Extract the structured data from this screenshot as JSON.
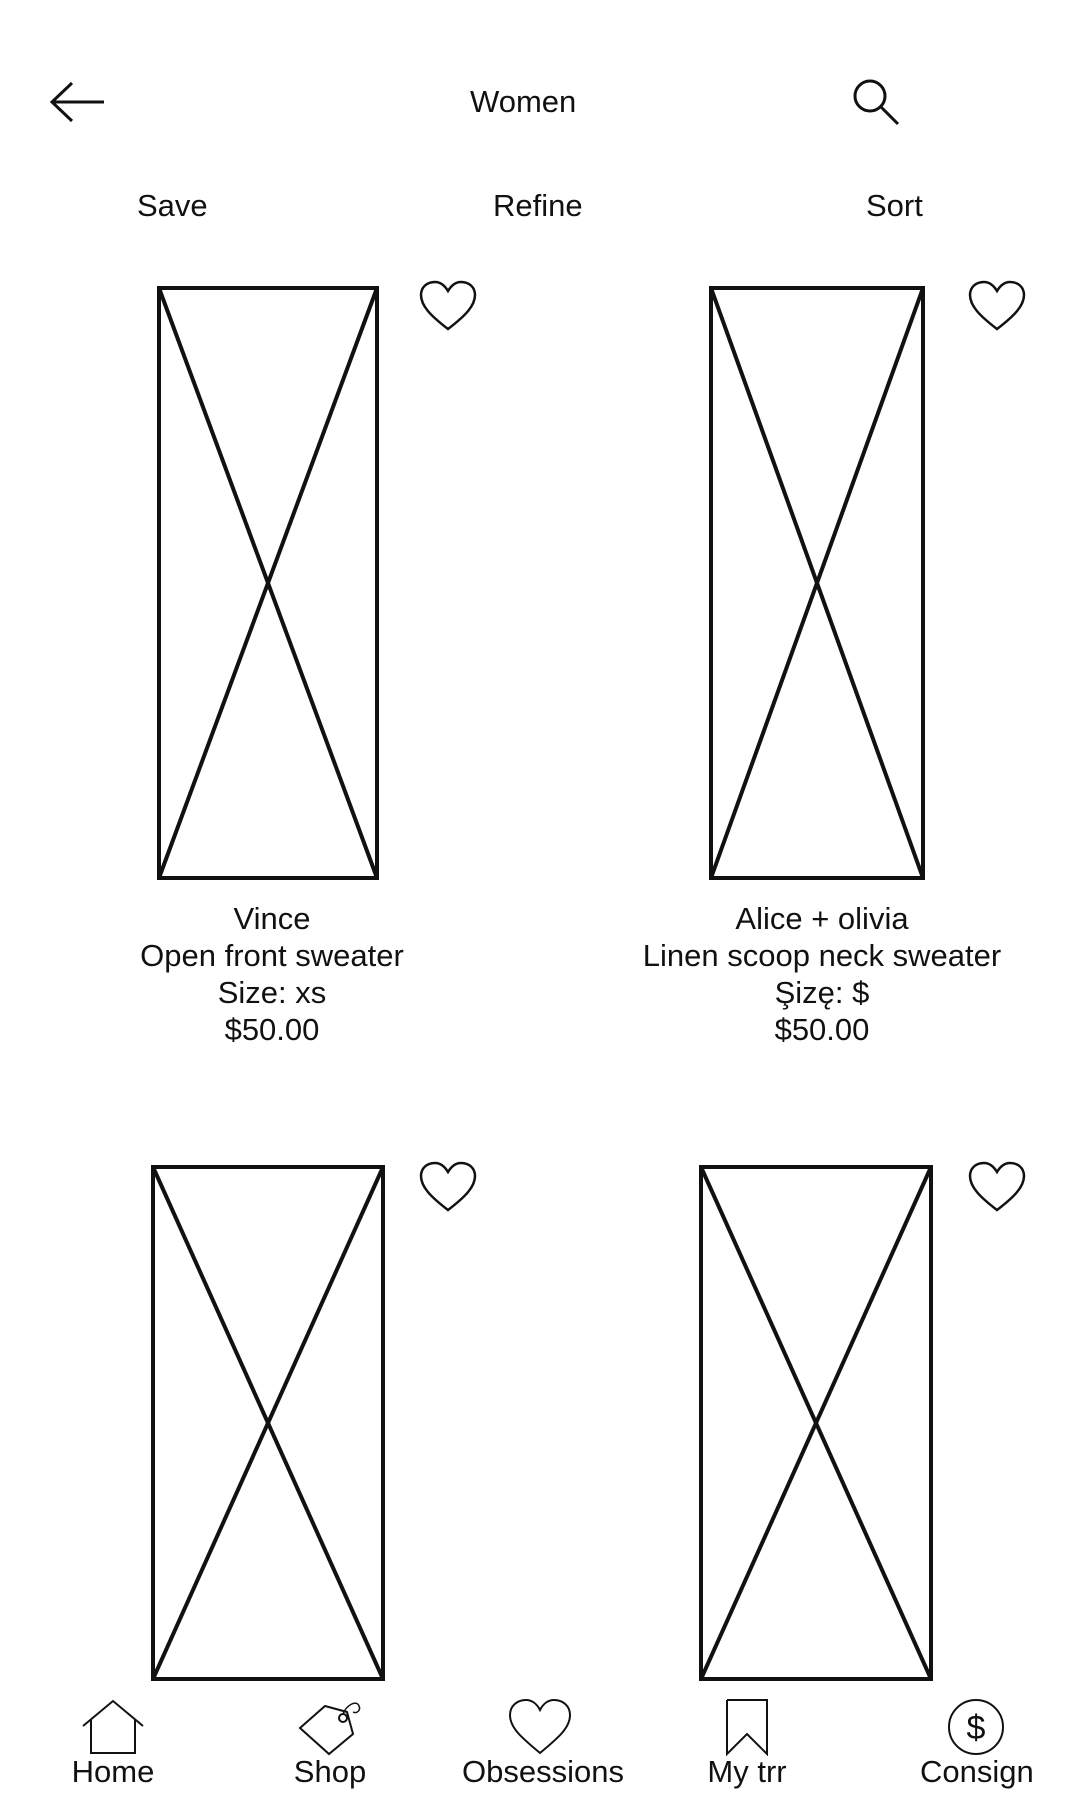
{
  "header": {
    "title": "Women",
    "back_icon": "arrow-left-icon",
    "search_icon": "search-icon"
  },
  "toolbar": {
    "save_label": "Save",
    "refine_label": "Refine",
    "sort_label": "Sort"
  },
  "products": [
    {
      "brand": "Vince",
      "name": "Open front sweater",
      "size": "Size: xs",
      "price": "$50.00"
    },
    {
      "brand": "Alice + olivia",
      "name": "Linen scoop neck sweater",
      "size": "Şizę: $",
      "price": "$50.00"
    },
    {
      "brand": "",
      "name": "",
      "size": "",
      "price": ""
    },
    {
      "brand": "",
      "name": "",
      "size": "",
      "price": ""
    }
  ],
  "bottom_nav": [
    {
      "label": "Home",
      "icon": "home-icon"
    },
    {
      "label": "Shop",
      "icon": "tag-icon"
    },
    {
      "label": "Obsessions",
      "icon": "heart-icon"
    },
    {
      "label": "My trr",
      "icon": "bookmark-icon"
    },
    {
      "label": "Consign",
      "icon": "dollar-circle-icon"
    }
  ],
  "colors": {
    "stroke": "#111111",
    "background": "#ffffff"
  }
}
